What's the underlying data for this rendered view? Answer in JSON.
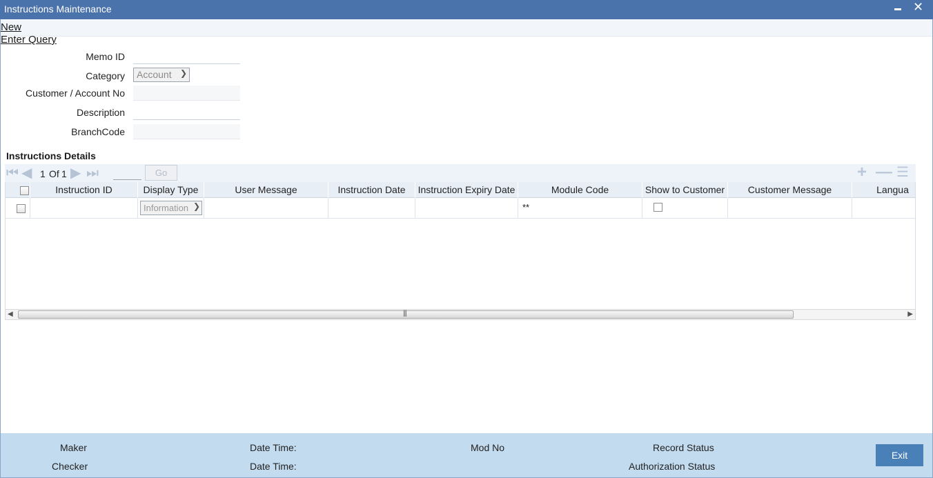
{
  "window": {
    "title": "Instructions Maintenance",
    "minimize_label": "▁",
    "close_label": "✕"
  },
  "menu": {
    "new_label": "New",
    "enter_query_label": "Enter Query"
  },
  "form": {
    "memo_id_label": "Memo ID",
    "category_label": "Category",
    "category_value": "Account",
    "customer_account_label": "Customer / Account No",
    "description_label": "Description",
    "branch_code_label": "BranchCode"
  },
  "details": {
    "section_title": "Instructions Details",
    "pager": {
      "current": "1",
      "of_label": "Of",
      "total": "1",
      "go_label": "Go"
    },
    "columns": [
      "Instruction ID",
      "Display Type",
      "User Message",
      "Instruction Date",
      "Instruction Expiry Date",
      "Module Code",
      "Show to Customer",
      "Customer Message",
      "Langua"
    ],
    "row": {
      "display_type_value": "Information",
      "module_code_value": "**"
    }
  },
  "footer": {
    "maker_label": "Maker",
    "checker_label": "Checker",
    "date_time_label": "Date Time:",
    "date_time_label_2": "Date Time:",
    "mod_no_label": "Mod No",
    "record_status_label": "Record Status",
    "authorization_status_label": "Authorization Status",
    "exit_label": "Exit"
  },
  "colors": {
    "titlebar": "#4a72ab",
    "footer": "#c3dbef",
    "exit_button": "#4a80b8"
  }
}
